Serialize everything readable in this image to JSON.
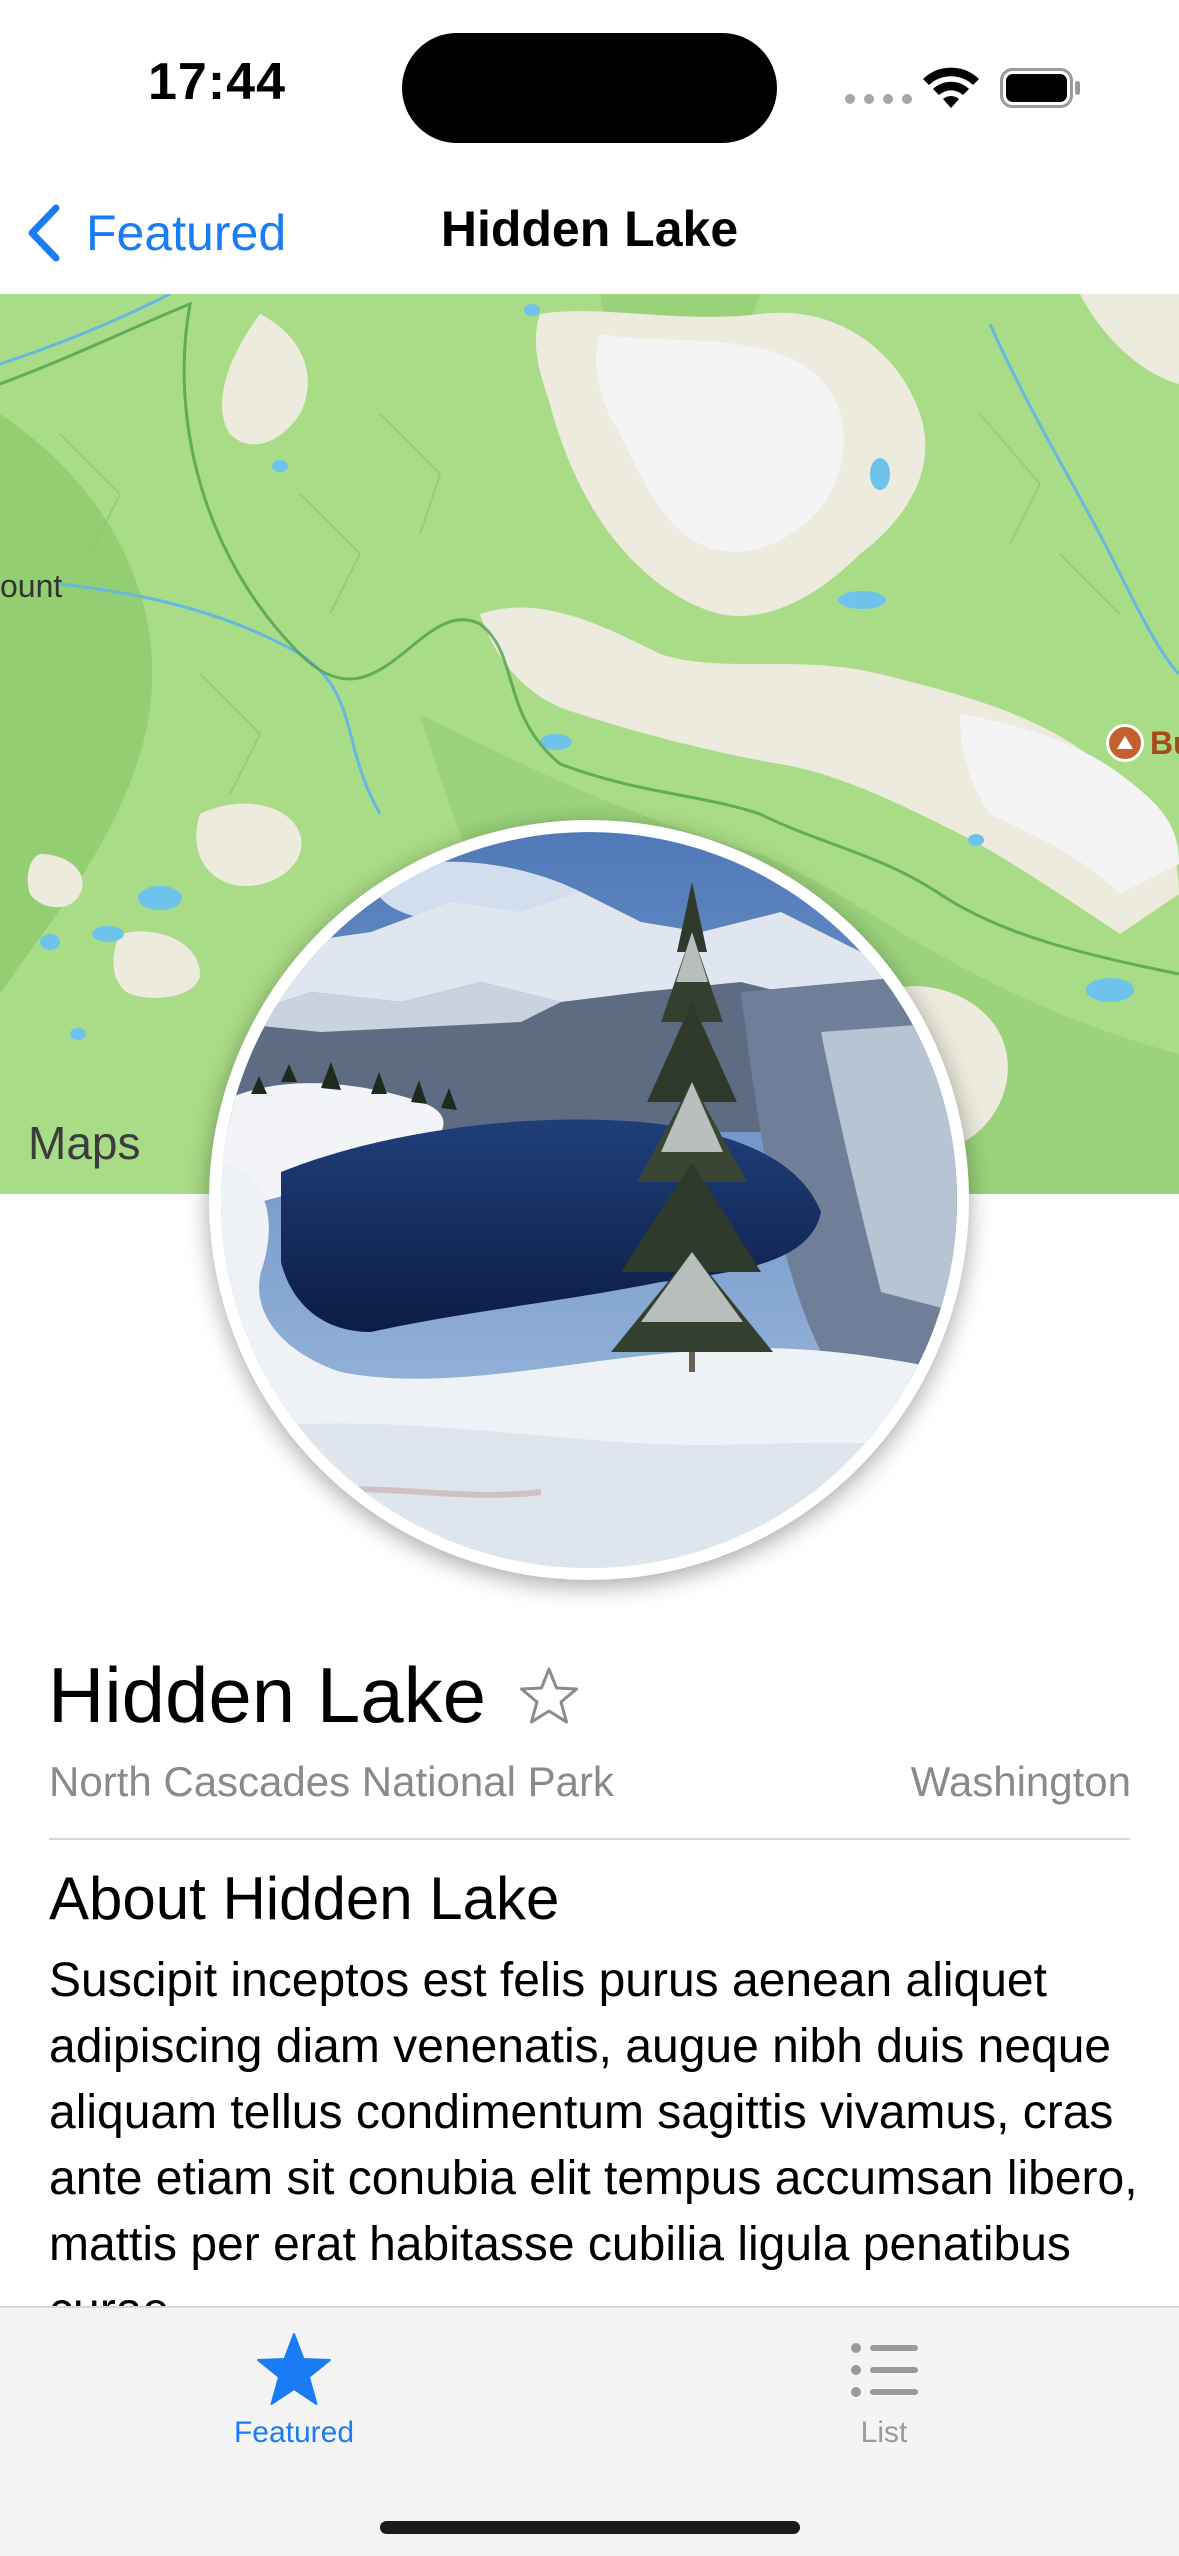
{
  "status_bar": {
    "time": "17:44",
    "icons": [
      "signal-dots-icon",
      "wifi-icon",
      "battery-icon"
    ]
  },
  "nav": {
    "back_label": "Featured",
    "back_icon": "chevron-left-icon",
    "title": "Hidden Lake"
  },
  "map": {
    "legal_label": "Maps",
    "label_left": "ount",
    "poi_label": "Bu"
  },
  "landmark": {
    "name": "Hidden Lake",
    "favorite_icon": "star-outline-icon",
    "park": "North Cascades National Park",
    "state": "Washington",
    "about_heading": "About Hidden Lake",
    "about_text": "Suscipit inceptos est felis purus aenean aliquet adipiscing diam venenatis, augue nibh duis neque aliquam tellus condimentum sagittis vivamus, cras ante etiam sit conubia elit tempus accumsan libero, mattis per erat habitasse cubilia ligula penatibus curae."
  },
  "tab_bar": {
    "tabs": [
      {
        "label": "Featured",
        "icon": "star-filled-icon",
        "selected": true
      },
      {
        "label": "List",
        "icon": "list-icon",
        "selected": false
      }
    ]
  },
  "colors": {
    "accent": "#1a7cf5",
    "secondary_text": "#8a8a8e",
    "map_green": "#a9dc86"
  }
}
